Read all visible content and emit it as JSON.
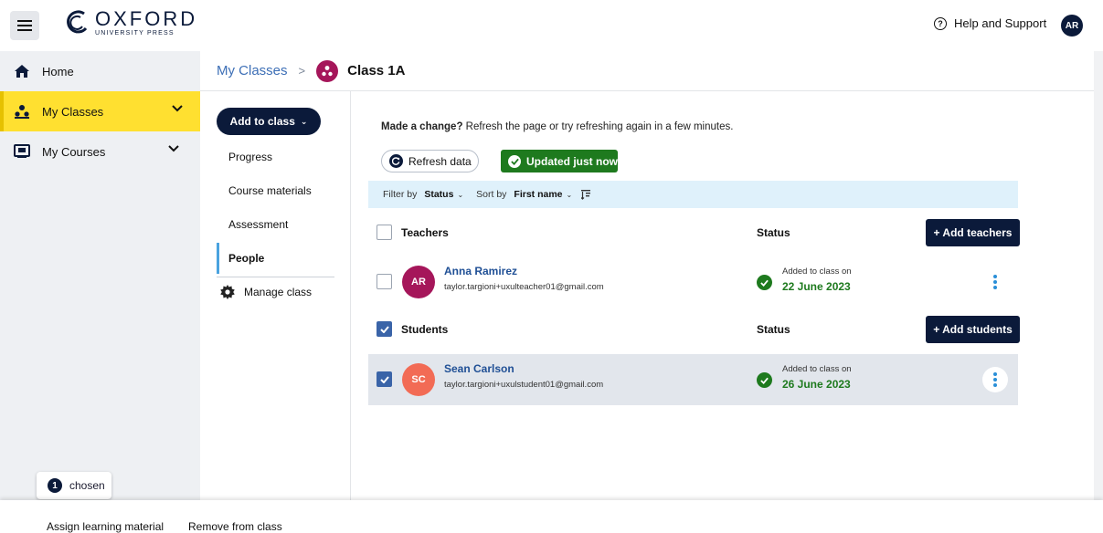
{
  "header": {
    "logo_main": "OXFORD",
    "logo_sub": "UNIVERSITY PRESS",
    "help_label": "Help and Support",
    "user_initials": "AR"
  },
  "sidebar": {
    "items": [
      {
        "label": "Home",
        "icon": "home-icon"
      },
      {
        "label": "My Classes",
        "icon": "classes-icon",
        "active": true
      },
      {
        "label": "My Courses",
        "icon": "book-icon"
      }
    ]
  },
  "breadcrumb": {
    "parent": "My Classes",
    "separator": ">",
    "current": "Class 1A"
  },
  "subnav": {
    "add_button": "Add to class",
    "items": [
      "Progress",
      "Course materials",
      "Assessment",
      "People"
    ],
    "active": "People",
    "manage": "Manage class"
  },
  "main": {
    "notice_bold": "Made a change?",
    "notice_text": "Refresh the page or try refreshing again in a few minutes.",
    "refresh_label": "Refresh data",
    "updated_label": "Updated just now",
    "filter": {
      "filter_by_label": "Filter by",
      "filter_value": "Status",
      "sort_by_label": "Sort by",
      "sort_value": "First name"
    },
    "teachers": {
      "heading": "Teachers",
      "status_heading": "Status",
      "add_button": "+ Add teachers",
      "rows": [
        {
          "initials": "AR",
          "name": "Anna Ramirez",
          "email": "taylor.targioni+uxulteacher01@gmail.com",
          "status_text": "Added to class on",
          "status_date": "22 June 2023",
          "avatar_color": "#a5165a"
        }
      ]
    },
    "students": {
      "heading": "Students",
      "status_heading": "Status",
      "add_button": "+ Add students",
      "rows": [
        {
          "initials": "SC",
          "name": "Sean Carlson",
          "email": "taylor.targioni+uxulstudent01@gmail.com",
          "status_text": "Added to class on",
          "status_date": "26 June 2023",
          "avatar_color": "#f26b55",
          "selected": true
        }
      ]
    }
  },
  "selection": {
    "count": "1",
    "label": "chosen"
  },
  "bottom_actions": {
    "assign": "Assign learning material",
    "remove": "Remove from class"
  }
}
